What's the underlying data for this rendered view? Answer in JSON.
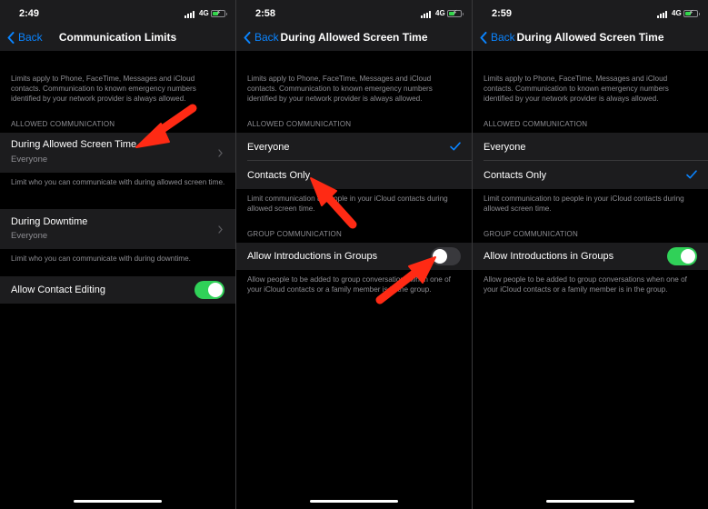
{
  "colors": {
    "accent": "#0a84ff",
    "toggle_on": "#30d158",
    "arrow": "#ff2a14",
    "cell": "#1c1c1e"
  },
  "screens": [
    {
      "status": {
        "time": "2:49",
        "network": "4G"
      },
      "nav": {
        "back": "Back",
        "title": "Communication Limits"
      },
      "intro_note": "Limits apply to Phone, FaceTime, Messages and iCloud contacts. Communication to known emergency numbers identified by your network provider is always allowed.",
      "section_header": "ALLOWED COMMUNICATION",
      "allowed_row": {
        "label": "During Allowed Screen Time",
        "value": "Everyone"
      },
      "allowed_note": "Limit who you can communicate with during allowed screen time.",
      "downtime_row": {
        "label": "During Downtime",
        "value": "Everyone"
      },
      "downtime_note": "Limit who you can communicate with during downtime.",
      "edit_row": {
        "label": "Allow Contact Editing",
        "toggle": "on"
      }
    },
    {
      "status": {
        "time": "2:58",
        "network": "4G"
      },
      "nav": {
        "back": "Back",
        "title": "During Allowed Screen Time"
      },
      "intro_note": "Limits apply to Phone, FaceTime, Messages and iCloud contacts. Communication to known emergency numbers identified by your network provider is always allowed.",
      "section_header": "ALLOWED COMMUNICATION",
      "options": [
        {
          "label": "Everyone",
          "selected": true
        },
        {
          "label": "Contacts Only",
          "selected": false
        }
      ],
      "options_note": "Limit communication to people in your iCloud contacts during allowed screen time.",
      "group_header": "GROUP COMMUNICATION",
      "group_row": {
        "label": "Allow Introductions in Groups",
        "toggle": "off"
      },
      "group_note": "Allow people to be added to group conversations when one of your iCloud contacts or a family member is in the group."
    },
    {
      "status": {
        "time": "2:59",
        "network": "4G"
      },
      "nav": {
        "back": "Back",
        "title": "During Allowed Screen Time"
      },
      "intro_note": "Limits apply to Phone, FaceTime, Messages and iCloud contacts. Communication to known emergency numbers identified by your network provider is always allowed.",
      "section_header": "ALLOWED COMMUNICATION",
      "options": [
        {
          "label": "Everyone",
          "selected": false
        },
        {
          "label": "Contacts Only",
          "selected": true
        }
      ],
      "options_note": "Limit communication to people in your iCloud contacts during allowed screen time.",
      "group_header": "GROUP COMMUNICATION",
      "group_row": {
        "label": "Allow Introductions in Groups",
        "toggle": "on"
      },
      "group_note": "Allow people to be added to group conversations when one of your iCloud contacts or a family member is in the group."
    }
  ]
}
